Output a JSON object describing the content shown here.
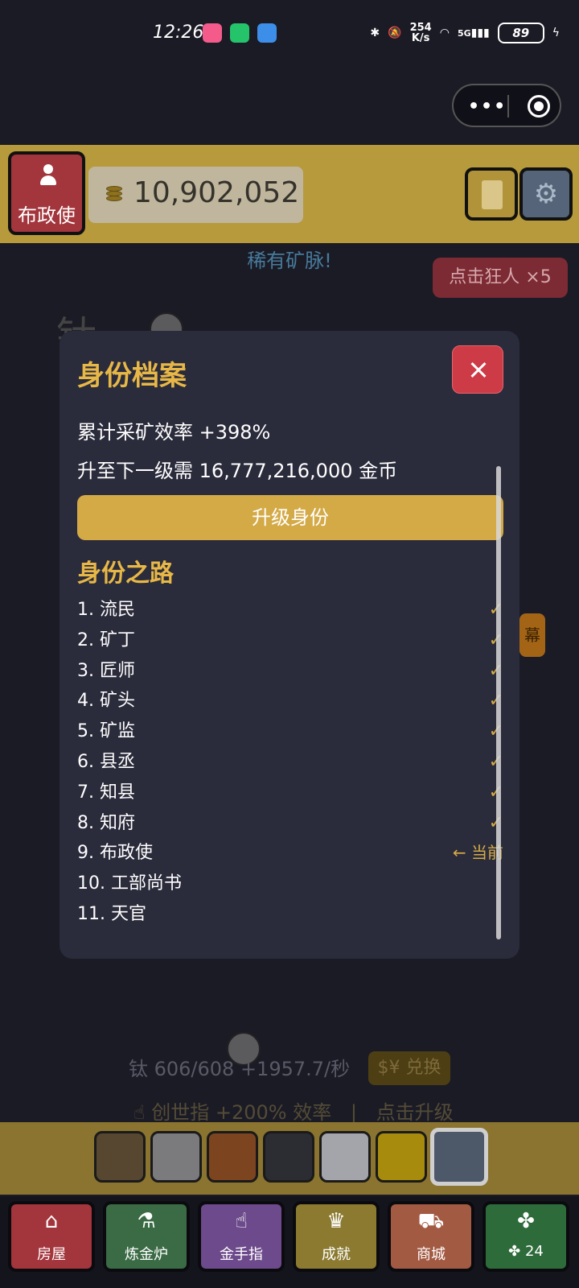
{
  "status_bar": {
    "time": "12:26",
    "net_speed_top": "254",
    "net_speed_bottom": "K/s",
    "network": "5G",
    "battery": "89"
  },
  "top_bar": {
    "rank_label": "布政使",
    "gold": "10,902,052"
  },
  "game": {
    "rare_text": "稀有矿脉!",
    "combo": "点击狂人 ×5",
    "ore_title": "钛",
    "side_tab": "幕",
    "ore_stat": "钛  606/608  +1957.7/秒",
    "exchange": "兑换",
    "finger_text": "创世指 +200% 效率",
    "finger_upgrade": "点击升级"
  },
  "ore_slots": [
    {
      "color": "#574630"
    },
    {
      "color": "#7b7b7e"
    },
    {
      "color": "#7d4420"
    },
    {
      "color": "#2c2d33"
    },
    {
      "color": "#a4a5ab"
    },
    {
      "color": "#a78b0c"
    },
    {
      "color": "#4d5869"
    }
  ],
  "modal": {
    "title": "身份档案",
    "efficiency": "累计采矿效率 +398%",
    "next_level": "升至下一级需 16,777,216,000 金币",
    "upgrade_button": "升级身份",
    "path_title": "身份之路",
    "current_marker": "← 当前",
    "ranks": [
      {
        "label": "1. 流民",
        "done": true
      },
      {
        "label": "2. 矿丁",
        "done": true
      },
      {
        "label": "3. 匠师",
        "done": true
      },
      {
        "label": "4. 矿头",
        "done": true
      },
      {
        "label": "5. 矿监",
        "done": true
      },
      {
        "label": "6. 县丞",
        "done": true
      },
      {
        "label": "7. 知县",
        "done": true
      },
      {
        "label": "8. 知府",
        "done": true
      },
      {
        "label": "9. 布政使",
        "current": true
      },
      {
        "label": "10. 工部尚书"
      },
      {
        "label": "11. 天官"
      }
    ]
  },
  "bottom_nav": [
    {
      "label": "房屋",
      "icon": "home-icon",
      "color": "#a3353c"
    },
    {
      "label": "炼金炉",
      "icon": "flask-icon",
      "color": "#3a6b45"
    },
    {
      "label": "金手指",
      "icon": "pointer-icon",
      "color": "#6d4a8b"
    },
    {
      "label": "成就",
      "icon": "trophy-icon",
      "color": "#8b7a30"
    },
    {
      "label": "商城",
      "icon": "cart-icon",
      "color": "#a35a43"
    },
    {
      "label": "24",
      "icon": "clover-icon",
      "color": "#2e6b3a"
    }
  ]
}
